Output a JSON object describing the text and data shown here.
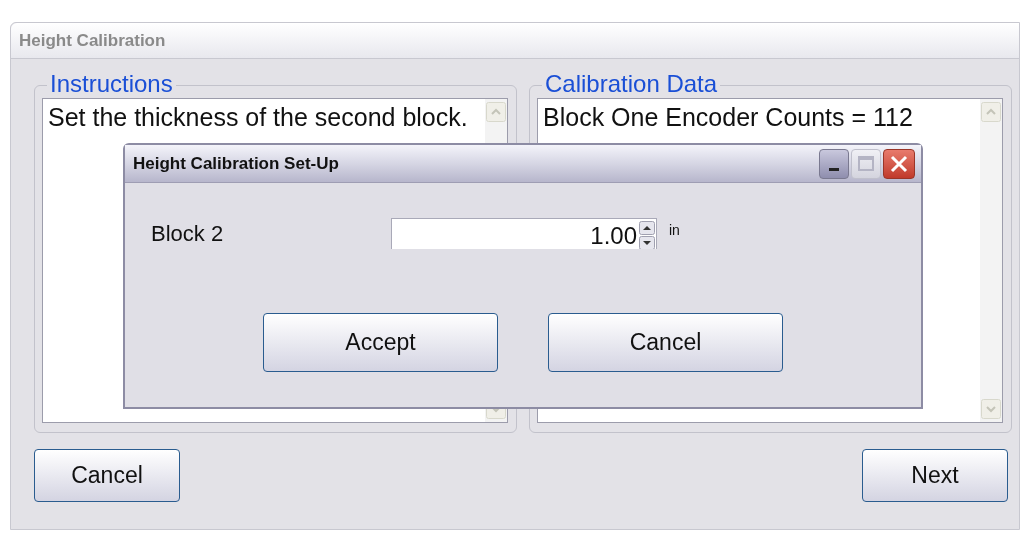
{
  "window": {
    "title": "Height Calibration"
  },
  "instructions": {
    "title": "Instructions",
    "text": "Set the thickness of the second block."
  },
  "calibration_data": {
    "title": "Calibration Data",
    "text": "Block One Encoder Counts = 112"
  },
  "buttons": [
    {
      "label": "Cancel",
      "kind": "left"
    },
    {
      "label": "Next",
      "kind": "right"
    }
  ],
  "dialog": {
    "title": "Height Calibration Set-Up",
    "field": {
      "label": "Block 2",
      "value": "1.00",
      "unit": "in"
    },
    "buttons": [
      {
        "label": "Accept"
      },
      {
        "label": "Cancel"
      }
    ]
  }
}
